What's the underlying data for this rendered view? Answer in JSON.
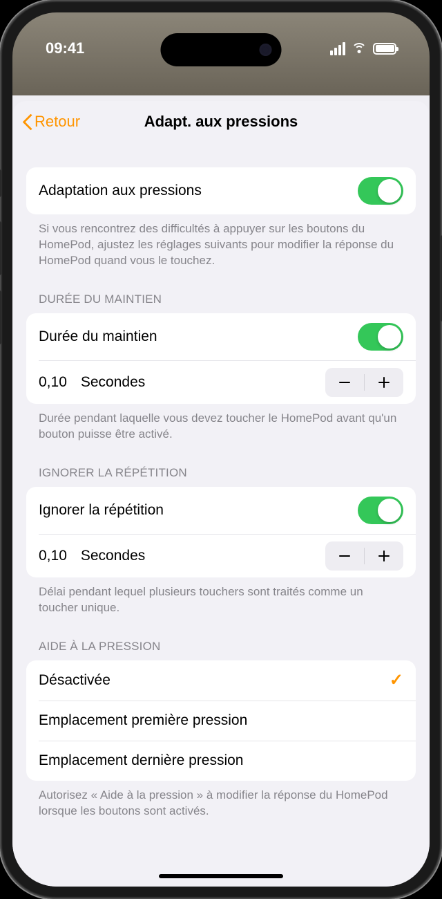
{
  "status": {
    "time": "09:41"
  },
  "nav": {
    "back": "Retour",
    "title": "Adapt. aux pressions"
  },
  "main": {
    "label": "Adaptation aux pressions",
    "footer": "Si vous rencontrez des difficultés à appuyer sur les boutons du HomePod, ajustez les réglages suivants pour modifier la réponse du HomePod quand vous le touchez."
  },
  "hold": {
    "header": "DURÉE DU MAINTIEN",
    "label": "Durée du maintien",
    "value": "0,10",
    "unit": "Secondes",
    "footer": "Durée pendant laquelle vous devez toucher le HomePod avant qu'un bouton puisse être activé."
  },
  "ignore": {
    "header": "IGNORER LA RÉPÉTITION",
    "label": "Ignorer la répétition",
    "value": "0,10",
    "unit": "Secondes",
    "footer": "Délai pendant lequel plusieurs touchers sont traités comme un toucher unique."
  },
  "assist": {
    "header": "AIDE À LA PRESSION",
    "options": [
      {
        "label": "Désactivée",
        "selected": true
      },
      {
        "label": "Emplacement première pression",
        "selected": false
      },
      {
        "label": "Emplacement dernière pression",
        "selected": false
      }
    ],
    "footer": "Autorisez « Aide à la pression » à modifier la réponse du HomePod lorsque les boutons sont activés."
  }
}
